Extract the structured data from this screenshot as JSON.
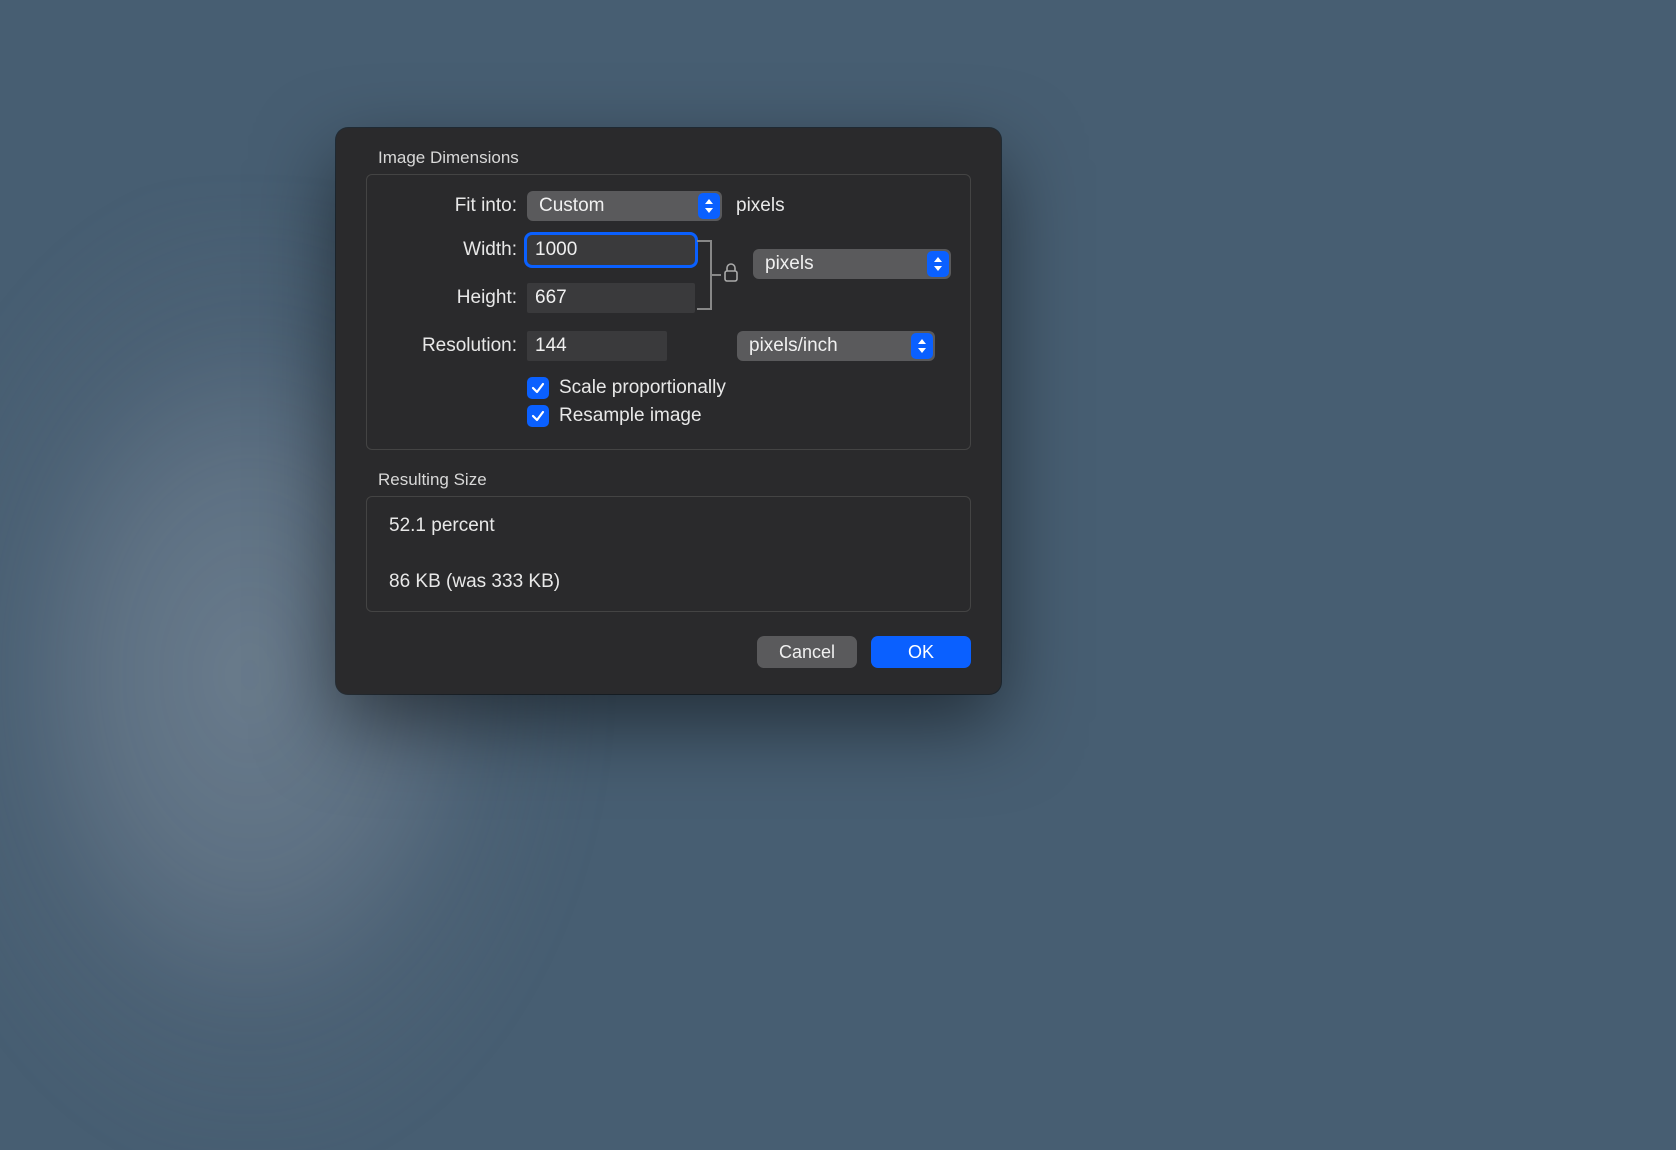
{
  "dialog": {
    "dimensions_title": "Image Dimensions",
    "fit_into_label": "Fit into:",
    "fit_into_value": "Custom",
    "fit_into_unit": "pixels",
    "width_label": "Width:",
    "width_value": "1000",
    "height_label": "Height:",
    "height_value": "667",
    "wh_unit_value": "pixels",
    "resolution_label": "Resolution:",
    "resolution_value": "144",
    "resolution_unit_value": "pixels/inch",
    "scale_checkbox_label": "Scale proportionally",
    "resample_checkbox_label": "Resample image",
    "resulting_title": "Resulting Size",
    "resulting_percent": "52.1 percent",
    "resulting_size": "86 KB (was 333 KB)",
    "cancel": "Cancel",
    "ok": "OK"
  }
}
